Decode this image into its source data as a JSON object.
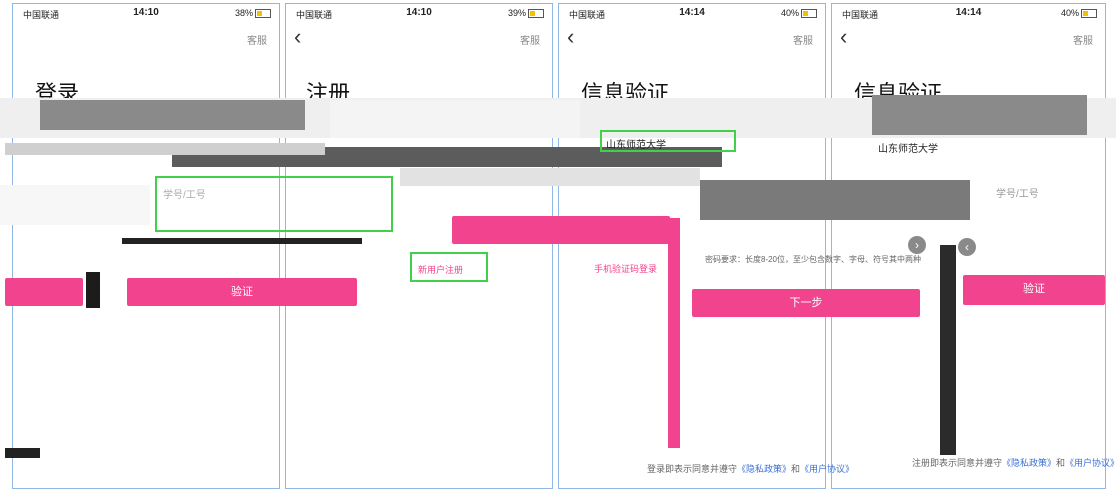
{
  "phones": [
    {
      "carrier": "中国联通",
      "time": "14:10",
      "battery": "38%",
      "service": "客服",
      "title": "登录",
      "student_id_placeholder": "学号/工号",
      "verify_button": "验证"
    },
    {
      "carrier": "中国联通",
      "time": "14:10",
      "battery": "39%",
      "service": "客服",
      "title": "注册",
      "new_user_link": "新用户注册",
      "sms_login_link": "手机验证码登录",
      "agree_prefix": "登录即表示同意并遵守",
      "privacy": "《隐私政策》",
      "and": "和",
      "terms": "《用户协议》"
    },
    {
      "carrier": "中国联通",
      "time": "14:14",
      "battery": "40%",
      "service": "客服",
      "title": "信息验证",
      "school": "山东师范大学",
      "password_hint": "密码要求：长度8-20位，至少包含数字、字母、符号其中两种",
      "next_button": "下一步"
    },
    {
      "carrier": "中国联通",
      "time": "14:14",
      "battery": "40%",
      "service": "客服",
      "title": "信息验证",
      "school": "山东师范大学",
      "student_id_placeholder": "学号/工号",
      "verify_button": "验证",
      "agree_prefix": "注册即表示同意并遵守",
      "privacy": "《隐私政策》",
      "and": "和",
      "terms": "《用户协议》"
    }
  ]
}
